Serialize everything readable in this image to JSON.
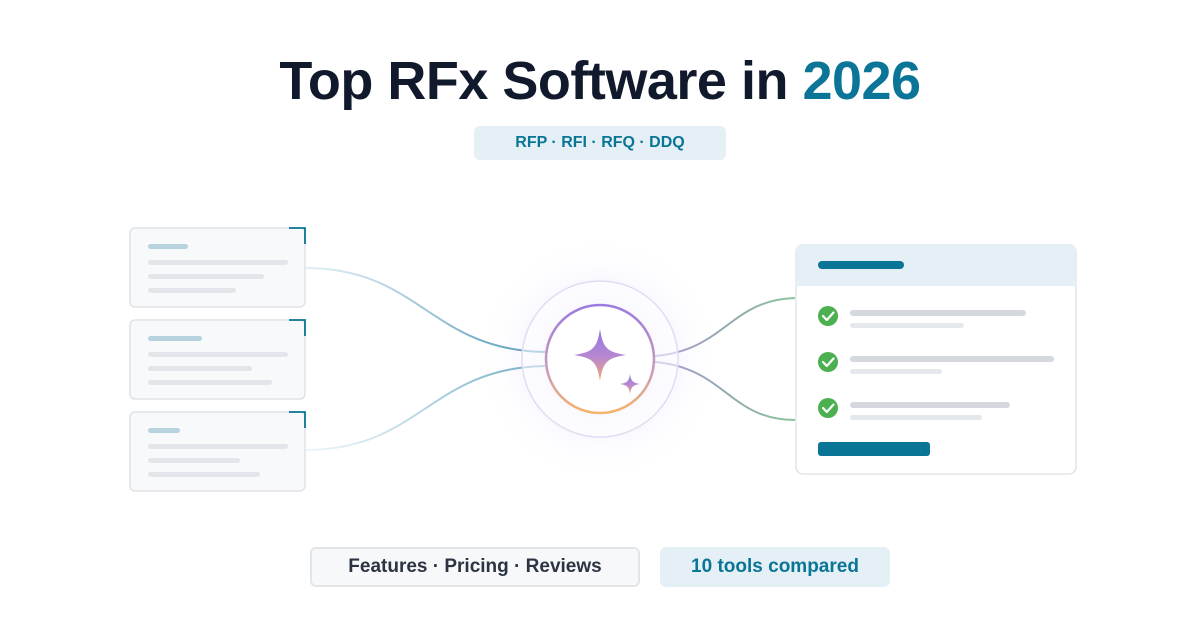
{
  "header": {
    "title_prefix": "Top RFx Software in ",
    "title_accent": "2026",
    "tag_line": "RFP · RFI · RFQ · DDQ"
  },
  "footer": {
    "features_label": "Features · Pricing · Reviews",
    "tools_label": "10 tools compared"
  },
  "illustration": {
    "input_documents": 3,
    "checklist_items_checked": 3,
    "center_icon": "sparkle-icon",
    "check_icon": "check-icon"
  },
  "colors": {
    "title": "#111a2c",
    "accent": "#0a7596",
    "pill_background": "#e4f0f5",
    "check_green": "#4caf50",
    "sparkle_purple": "#9b7ee0",
    "sparkle_orange": "#f5b26b"
  }
}
